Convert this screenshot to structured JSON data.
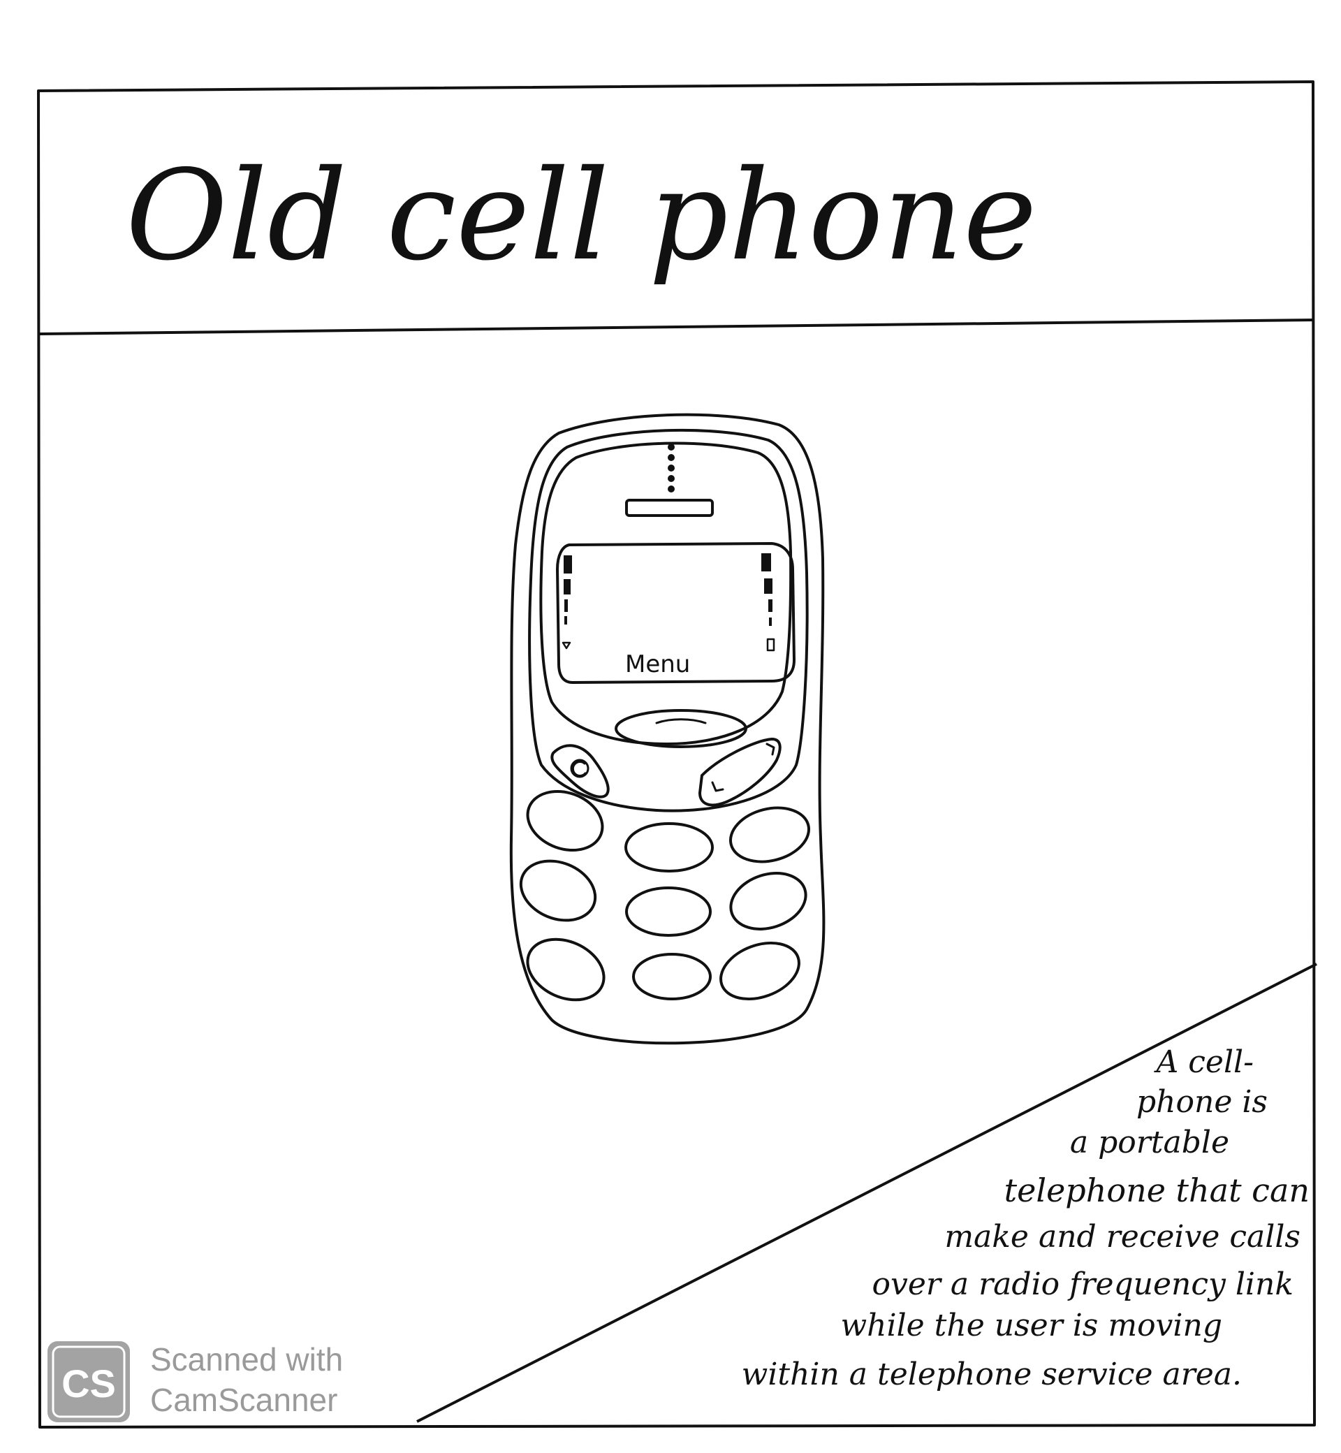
{
  "title": "Old cell phone",
  "phone": {
    "screen_label": "Menu"
  },
  "description": {
    "lines": [
      "A cell-",
      "phone is",
      "a portable",
      "telephone that can",
      "make and receive calls",
      "over a radio frequency link",
      "while the user is moving",
      "within a telephone service area."
    ]
  },
  "watermark": {
    "logo_text": "CS",
    "line1": "Scanned with",
    "line2": "CamScanner"
  },
  "colors": {
    "ink": "#111111",
    "paper": "#ffffff",
    "watermark": "#9a9a9a"
  }
}
